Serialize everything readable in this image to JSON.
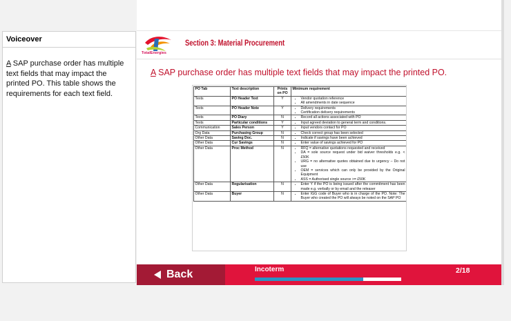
{
  "voiceover": {
    "title": "Voiceover",
    "first_letter": "A",
    "text": " SAP purchase order has multiple text  fields that may impact the printed PO. This table shows the requirements for each text field."
  },
  "header": {
    "logo_text": "TotalEnergies",
    "section_title": "Section 3: Material Procurement"
  },
  "slide": {
    "heading_first": "A",
    "heading_rest": " SAP purchase order has multiple text  fields that may impact the printed PO."
  },
  "table": {
    "headers": [
      "PO Tab",
      "Text description",
      "Prints on PO",
      "Minimum requirement"
    ],
    "rows": [
      {
        "tab": "Texts",
        "desc": "PO Header Text",
        "prints": "Y",
        "req": [
          "Vendor quotation reference",
          "All amendments in date sequence"
        ]
      },
      {
        "tab": "Texts",
        "desc": "PO Header Note",
        "prints": "Y",
        "req": [
          "Delivery requirements",
          "Certification delivery requirements"
        ]
      },
      {
        "tab": "Texts",
        "desc": "PO Diary",
        "prints": "N",
        "req": [
          "Record all actions associated with PO"
        ]
      },
      {
        "tab": "Texts",
        "desc": "Particular conditions",
        "prints": "Y",
        "req": [
          "Input agreed deviation to general term and conditions."
        ]
      },
      {
        "tab": "Communication",
        "desc": "Sales Person",
        "prints": "Y",
        "req": [
          "Input vendors contact for PO"
        ]
      },
      {
        "tab": "Org Data",
        "desc": "Purchasing Group",
        "prints": "N",
        "req": [
          "Check correct group has been selected"
        ]
      },
      {
        "tab": "Other Data",
        "desc": "Saving Doc.",
        "prints": "N",
        "req": [
          "Indicate if savings have been achieved"
        ]
      },
      {
        "tab": "Other Data",
        "desc": "Cur Savings",
        "prints": "N",
        "req": [
          "Enter value of savings achieved for PO"
        ]
      },
      {
        "tab": "Other Data",
        "desc": "Proc Method",
        "prints": "N",
        "req": [
          "RFQ = alternative quotations requested and received",
          "DA = sole source request under bid waiver thresholds e.g. < £50K",
          "URG = no alternative quotes obtained due to urgency – Do not use",
          "OEM = services which can only be provided by the Original Equipment",
          "ASS = Authorised single source >= £50K"
        ]
      },
      {
        "tab": "Other Data",
        "desc": "Regularisation",
        "prints": "N",
        "req": [
          "Enter Y if the PO is being issued after the commitment has been made e.g. verbally or by email and the releaser"
        ]
      },
      {
        "tab": "Other Data",
        "desc": "Buyer",
        "prints": "N",
        "req": [
          "Enter IGG code of Buyer who is in charge of the PO. Note: The Buyer who created the PO will always be noted on the SAP PO"
        ]
      }
    ]
  },
  "footer": {
    "back_label": "Back",
    "topic": "Incoterm",
    "page": "2/18",
    "progress": 0.74
  },
  "colors": {
    "accent": "#e0143c",
    "back_bg": "#a31a35",
    "progress": "#2d93c4",
    "heading": "#c0102b"
  }
}
